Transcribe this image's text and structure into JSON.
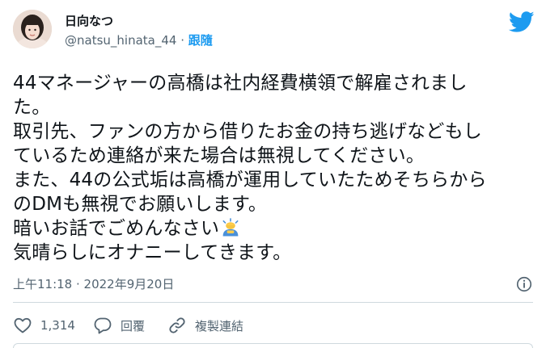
{
  "author": {
    "display_name": "日向なつ",
    "handle": "@natsu_hinata_44",
    "separator": "·",
    "follow_label": "跟隨"
  },
  "tweet": {
    "lines": [
      "44マネージャーの高橋は社内経費横領で解雇されまし",
      "た。",
      "取引先、ファンの方から借りたお金の持ち逃げなどもし",
      "ているため連絡が来た場合は無視してください。",
      "また、44の公式垢は高橋が運用していたためそちらから",
      "のDMも無視でお願いします。",
      "暗いお話でごめんなさい",
      "気晴らしにオナニーしてきます。"
    ],
    "emoji_icon": "person-bowing-emoji"
  },
  "meta": {
    "timestamp": "上午11:18 · 2022年9月20日"
  },
  "actions": {
    "like_count": "1,314",
    "reply_label": "回覆",
    "copy_link_label": "複製連結"
  },
  "colors": {
    "brand_blue": "#1d9bf0",
    "muted_text": "#536471",
    "divider": "#cfd9de"
  },
  "icons": [
    "twitter-bird-icon",
    "info-icon",
    "heart-icon",
    "reply-icon",
    "link-icon"
  ]
}
